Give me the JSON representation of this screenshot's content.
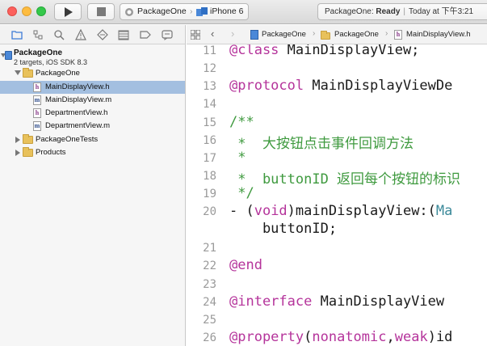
{
  "toolbar": {
    "scheme_project": "PackageOne",
    "scheme_device": "iPhone 6",
    "status_project": "PackageOne:",
    "status_state": "Ready",
    "status_time": "Today at 下午3:21"
  },
  "navigator": {
    "project_name": "PackageOne",
    "project_subtitle": "2 targets, iOS SDK 8.3",
    "items": [
      {
        "label": "PackageOne",
        "kind": "folder"
      },
      {
        "label": "MainDisplayView.h",
        "kind": "h"
      },
      {
        "label": "MainDisplayView.m",
        "kind": "m"
      },
      {
        "label": "DepartmentView.h",
        "kind": "h"
      },
      {
        "label": "DepartmentView.m",
        "kind": "m"
      },
      {
        "label": "PackageOneTests",
        "kind": "folder"
      },
      {
        "label": "Products",
        "kind": "folder"
      }
    ]
  },
  "jumpbar": {
    "crumb1": "PackageOne",
    "crumb2": "PackageOne",
    "crumb3": "MainDisplayView.h"
  },
  "editor": {
    "line_numbers": [
      "11",
      "12",
      "13",
      "14",
      "15",
      "16",
      "17",
      "18",
      "19",
      "20",
      "21",
      "22",
      "23",
      "24",
      "25",
      "26"
    ],
    "lines": {
      "l11_kw": "@class",
      "l11_rest": " MainDisplayView;",
      "l13_kw": "@protocol",
      "l13_rest": " MainDisplayViewDe",
      "l15": "/**",
      "l16": " *  大按钮点击事件回调方法",
      "l17": " *",
      "l18": " *  buttonID 返回每个按钮的标识",
      "l19": " */",
      "l20_a": "- (",
      "l20_kw": "void",
      "l20_b": ")mainDisplayView:(",
      "l20_ty": "Ma",
      "l20_cont": "    buttonID;",
      "l22_kw": "@end",
      "l24_kw": "@interface",
      "l24_rest": " MainDisplayView",
      "l26_kw": "@property",
      "l26_a": "(",
      "l26_kw2": "nonatomic",
      "l26_b": ",",
      "l26_kw3": "weak",
      "l26_c": ")id"
    }
  }
}
